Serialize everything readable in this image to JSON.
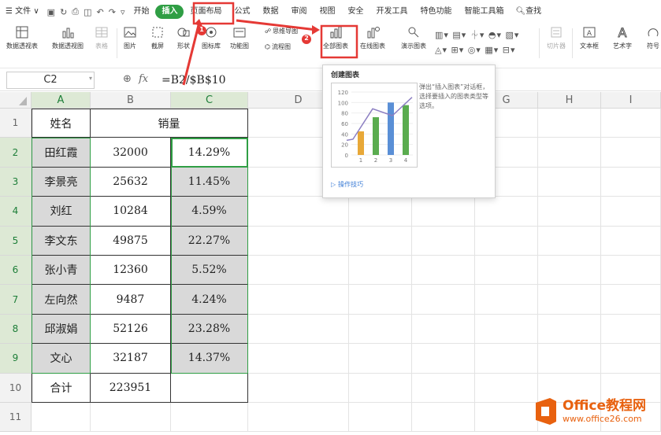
{
  "menu": {
    "file": "文件",
    "tabs": [
      "开始",
      "插入",
      "页面布局",
      "公式",
      "数据",
      "审阅",
      "视图",
      "安全",
      "开发工具",
      "特色功能",
      "智能工具箱"
    ],
    "search": "查找"
  },
  "ribbon": {
    "buttons": [
      "数据透视表",
      "数据透视图",
      "表格",
      "图片",
      "截屏",
      "形状",
      "图标库",
      "功能图",
      "流程图",
      "全部图表",
      "在线图表",
      "演示图表",
      "切片器",
      "文本框",
      "艺术字",
      "符号"
    ],
    "mindmap": "思维导图"
  },
  "formula_bar": {
    "cell_ref": "C2",
    "fx": "fx",
    "formula": "=B2/$B$10"
  },
  "sheet": {
    "columns": [
      "A",
      "B",
      "C",
      "D",
      "E",
      "F",
      "G",
      "H",
      "I"
    ],
    "rows": [
      "1",
      "2",
      "3",
      "4",
      "5",
      "6",
      "7",
      "8",
      "9",
      "10",
      "11"
    ],
    "header_name": "姓名",
    "header_sales": "销量",
    "data": [
      {
        "name": "田红霞",
        "sales": "32000",
        "pct": "14.29%"
      },
      {
        "name": "李景亮",
        "sales": "25632",
        "pct": "11.45%"
      },
      {
        "name": "刘红",
        "sales": "10284",
        "pct": "4.59%"
      },
      {
        "name": "李文东",
        "sales": "49875",
        "pct": "22.27%"
      },
      {
        "name": "张小青",
        "sales": "12360",
        "pct": "5.52%"
      },
      {
        "name": "左向然",
        "sales": "9487",
        "pct": "4.24%"
      },
      {
        "name": "邱淑娟",
        "sales": "52126",
        "pct": "23.28%"
      },
      {
        "name": "文心",
        "sales": "32187",
        "pct": "14.37%"
      }
    ],
    "total_label": "合计",
    "total_value": "223951"
  },
  "tooltip": {
    "title": "创建图表",
    "desc": "弹出“插入图表”对话框，选择要插入的图表类型等选项。",
    "link": "操作技巧",
    "chart_yticks": [
      "120",
      "100",
      "80",
      "60",
      "40",
      "20",
      "0"
    ],
    "chart_xticks": [
      "1",
      "2",
      "3",
      "4"
    ],
    "chart_values": [
      45,
      72,
      100,
      95
    ],
    "chart_line": [
      30,
      88,
      75,
      110
    ],
    "bar_colors": [
      "#e8a838",
      "#5aac4f",
      "#5a8fd6",
      "#5aac4f"
    ]
  },
  "annotations": {
    "step1": "1",
    "step2": "2"
  },
  "watermark": {
    "brand": "Office教程网",
    "url": "www.office26.com"
  },
  "colors": {
    "accent_green": "#2f9e44",
    "highlight_red": "#e53935",
    "selected_fill": "#d9d9d9"
  }
}
